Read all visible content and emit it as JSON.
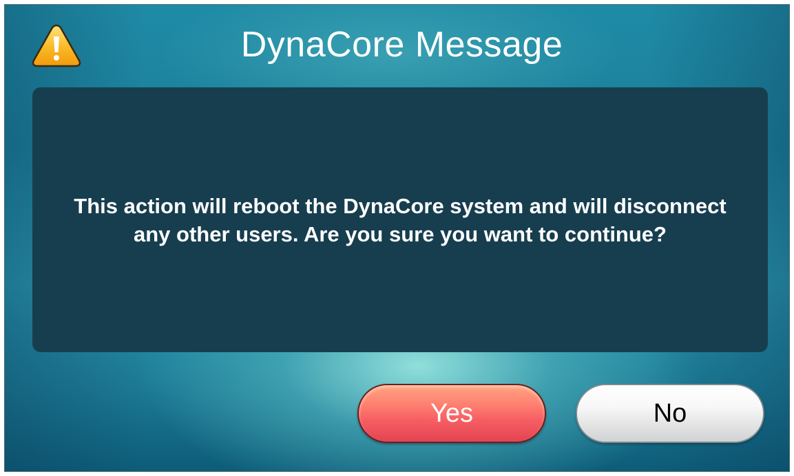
{
  "dialog": {
    "title": "DynaCore Message",
    "icon": "warning-icon",
    "message": "This action will reboot the DynaCore system and will disconnect any other users. Are you sure you want to continue?",
    "buttons": {
      "yes_label": "Yes",
      "no_label": "No"
    }
  },
  "colors": {
    "panel": "#173e4f",
    "yes_button": "#f75e63",
    "no_button": "#e4e4e4",
    "warning": "#f4b71f"
  }
}
